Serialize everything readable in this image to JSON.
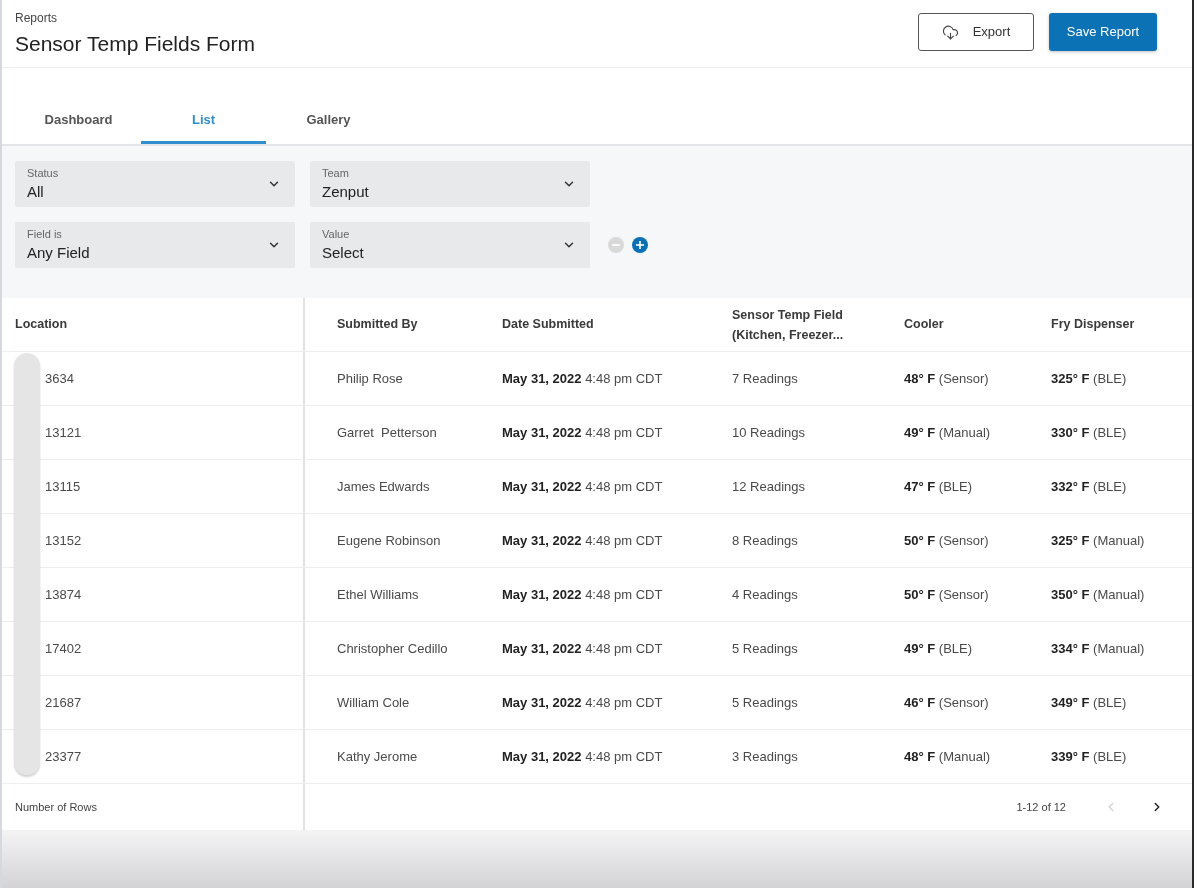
{
  "header": {
    "breadcrumb": "Reports",
    "title": "Sensor Temp Fields Form",
    "buttons": [
      {
        "label": "Export",
        "kind": "outline"
      },
      {
        "label": "Save Report",
        "kind": "primary"
      }
    ]
  },
  "tabs": [
    {
      "label": "Dashboard",
      "selected": false
    },
    {
      "label": "List",
      "selected": true
    },
    {
      "label": "Gallery",
      "selected": false
    }
  ],
  "filters": [
    {
      "label": "Status",
      "value": "All"
    },
    {
      "label": "Team",
      "value": "Zenput"
    },
    {
      "label": "Field is",
      "value": "Any Field"
    },
    {
      "label": "Value",
      "value": "Select"
    }
  ],
  "filter_actions": [
    {
      "kind": "remove",
      "disabled": true
    },
    {
      "kind": "add",
      "disabled": false
    }
  ],
  "table": {
    "columns": [
      "Location",
      "Submitted By",
      "Date Submitted",
      "Sensor Temp Field (Kitchen, Freezer...",
      "Cooler",
      "Fry Dispenser"
    ],
    "rows": [
      {
        "cells": [
          "3634",
          "Philip Rose",
          "**May 31, 2022** 4:48 pm CDT",
          "7 Readings",
          "**48° F** (Sensor)",
          "**325° F** (BLE)"
        ]
      },
      {
        "cells": [
          "13121",
          "Garret  Petterson",
          "**May 31, 2022** 4:48 pm CDT",
          "10 Readings",
          "**49° F** (Manual)",
          "**330° F** (BLE)"
        ]
      },
      {
        "cells": [
          "13115",
          "James Edwards",
          "**May 31, 2022** 4:48 pm CDT",
          "12 Readings",
          "**47° F** (BLE)",
          "**332° F** (BLE)"
        ]
      },
      {
        "cells": [
          "13152",
          "Eugene Robinson",
          "**May 31, 2022** 4:48 pm CDT",
          "8 Readings",
          "**50° F** (Sensor)",
          "**325° F** (Manual)"
        ]
      },
      {
        "cells": [
          "13874",
          "Ethel Williams",
          "**May 31, 2022** 4:48 pm CDT",
          "4 Readings",
          "**50° F** (Sensor)",
          "**350° F** (Manual)"
        ]
      },
      {
        "cells": [
          "17402",
          "Christopher Cedillo",
          "**May 31, 2022** 4:48 pm CDT",
          "5 Readings",
          "**49° F** (BLE)",
          "**334° F** (Manual)"
        ]
      },
      {
        "cells": [
          "21687",
          "William Cole",
          "**May 31, 2022** 4:48 pm CDT",
          "5 Readings",
          "**46° F** (Sensor)",
          "**349° F** (BLE)"
        ]
      },
      {
        "cells": [
          "23377",
          "Kathy Jerome",
          "**May 31, 2022** 4:48 pm CDT",
          "3 Readings",
          "**48° F** (Manual)",
          "**339° F** (BLE)"
        ]
      }
    ]
  },
  "footer": {
    "rows_label": "Number of Rows",
    "range": "1-12 of 12",
    "pager": [
      {
        "kind": "prev",
        "disabled": true
      },
      {
        "kind": "next",
        "disabled": false
      }
    ]
  }
}
